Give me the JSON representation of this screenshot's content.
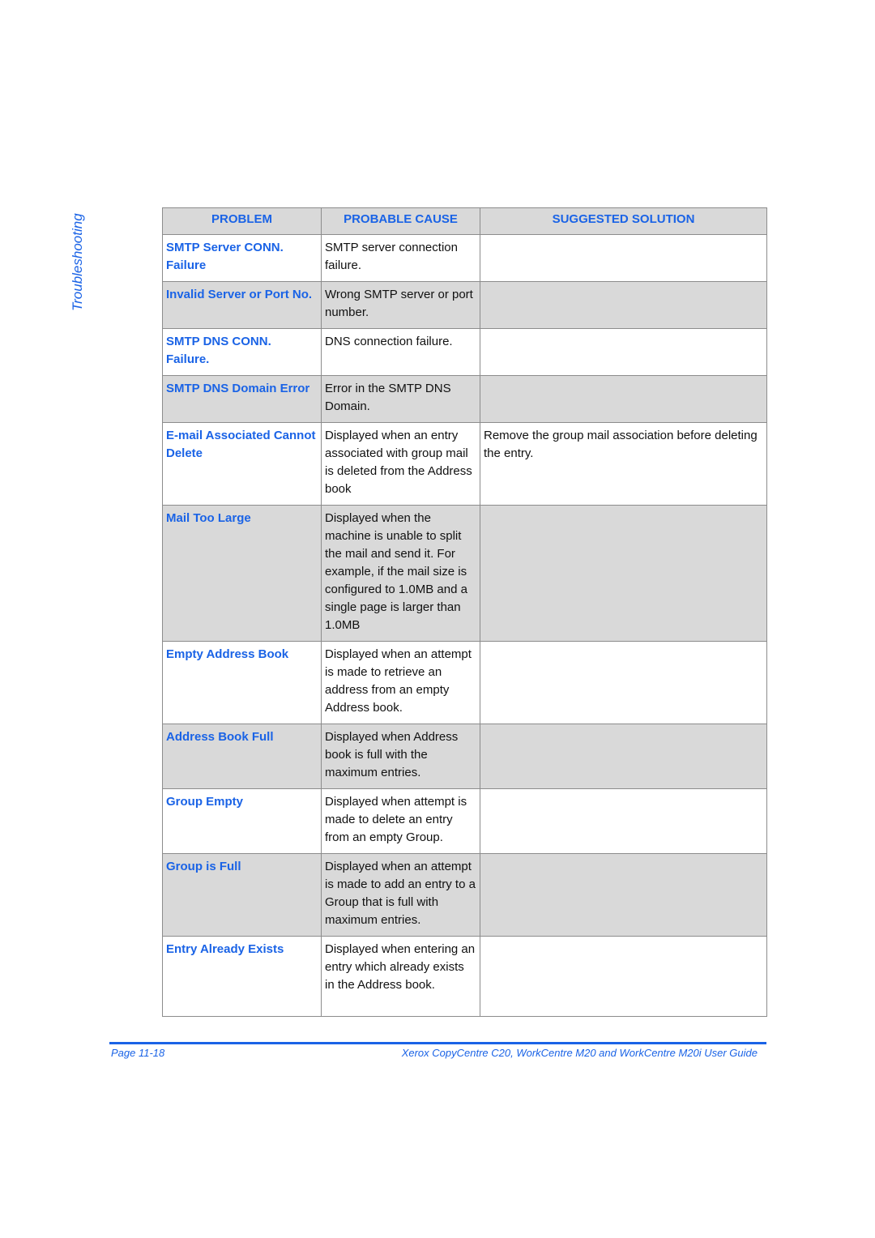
{
  "side_title": "Troubleshooting",
  "table": {
    "headers": [
      "PROBLEM",
      "PROBABLE CAUSE",
      "SUGGESTED SOLUTION"
    ],
    "rows": [
      {
        "problem": "SMTP Server CONN. Failure",
        "cause": "SMTP server connection failure.",
        "solution": "",
        "shaded": false
      },
      {
        "problem": "Invalid Server or Port No.",
        "cause": "Wrong SMTP server or port number.",
        "solution": "",
        "shaded": true
      },
      {
        "problem": "SMTP DNS CONN. Failure.",
        "cause": "DNS connection failure.",
        "solution": "",
        "shaded": false
      },
      {
        "problem": "SMTP DNS Domain Error",
        "cause": "Error in the SMTP DNS Domain.",
        "solution": "",
        "shaded": true
      },
      {
        "problem": "E-mail Associated Cannot Delete",
        "cause": "Displayed when an entry associated with group mail is deleted from the Address book",
        "solution": "Remove the group mail association before deleting the entry.",
        "shaded": false
      },
      {
        "problem": "Mail Too Large",
        "cause": "Displayed when the machine is unable to split the mail and send it. For example, if the mail size is configured to 1.0MB and a single page is larger than 1.0MB",
        "solution": "",
        "shaded": true
      },
      {
        "problem": "Empty Address Book",
        "cause": "Displayed when an attempt is made to retrieve an address from an empty Address book.",
        "solution": "",
        "shaded": false
      },
      {
        "problem": "Address Book Full",
        "cause": "Displayed when Address book is full with the maximum entries.",
        "solution": "",
        "shaded": true
      },
      {
        "problem": "Group Empty",
        "cause": "Displayed when attempt is made to delete an entry from an empty Group.",
        "solution": "",
        "shaded": false
      },
      {
        "problem": "Group is Full",
        "cause": "Displayed when an attempt is made to add an entry to a Group that is full with maximum entries.",
        "solution": "",
        "shaded": true
      },
      {
        "problem": "Entry Already Exists",
        "cause": "Displayed when entering an entry which already exists in the Address book.",
        "solution": "",
        "shaded": false
      }
    ]
  },
  "footer": {
    "page": "Page 11-18",
    "guide": "Xerox CopyCentre C20, WorkCentre M20 and WorkCentre M20i User Guide"
  },
  "colors": {
    "accent": "#1a63e6",
    "shade": "#d9d9d9",
    "border": "#8c8c8c"
  }
}
